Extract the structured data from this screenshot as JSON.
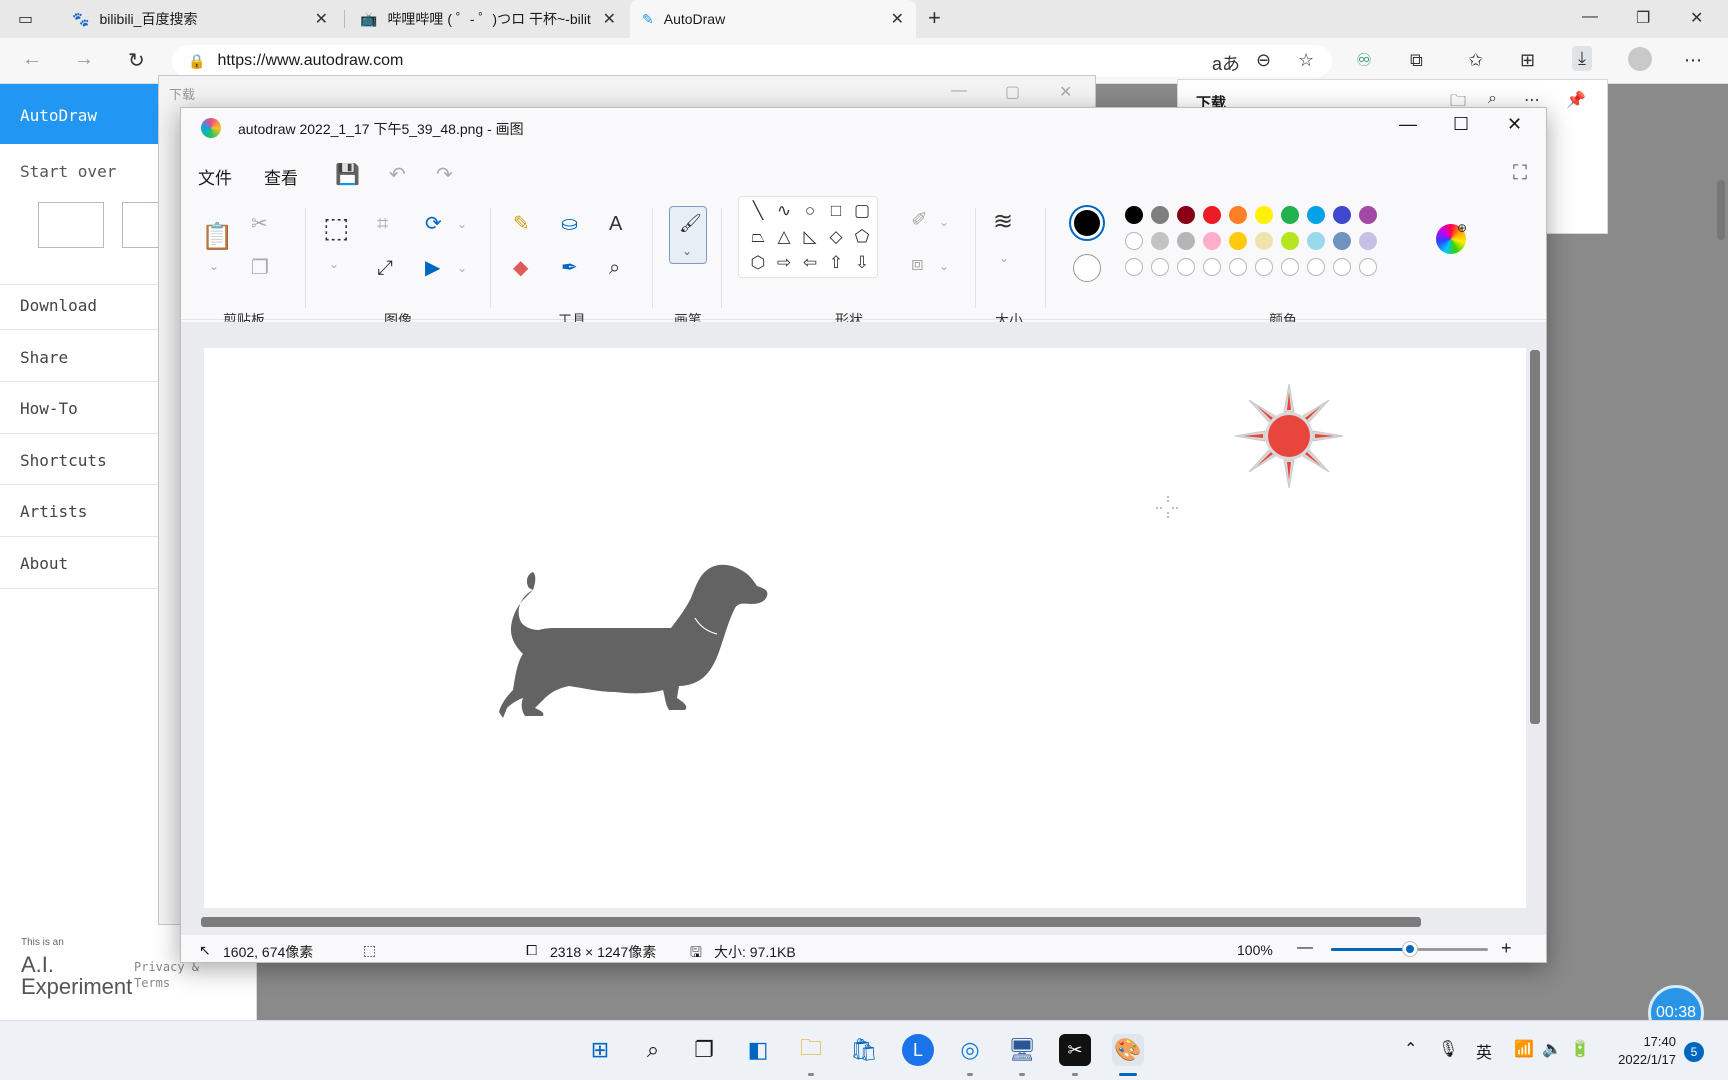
{
  "browser": {
    "tabs": [
      {
        "title": "bilibili_百度搜索"
      },
      {
        "title": "哔哩哔哩 ( ゜- ゜)つロ 干杯~-bilit"
      },
      {
        "title": "AutoDraw"
      }
    ],
    "new_tab": "+",
    "url": "https://www.autodraw.com"
  },
  "autodraw": {
    "brand": "AutoDraw",
    "start_over": "Start over",
    "menu": [
      "Download",
      "Share",
      "How-To",
      "Shortcuts",
      "Artists",
      "About"
    ],
    "footer_small": "This is an",
    "footer_brand_line1": "A.I.",
    "footer_brand_line2": "Experiment",
    "footer_links": [
      "Privacy &",
      "Terms"
    ]
  },
  "download_window": {
    "title": "下载"
  },
  "download_flyout": {
    "title": "下载"
  },
  "paint": {
    "title": "autodraw 2022_1_17 下午5_39_48.png - 画图",
    "menu": {
      "file": "文件",
      "view": "查看"
    },
    "groups": {
      "clipboard": "剪贴板",
      "image": "图像",
      "tools": "工具",
      "brushes": "画笔",
      "shapes": "形状",
      "size": "大小",
      "colors": "颜色"
    },
    "palette_row1": [
      "#000000",
      "#7f7f7f",
      "#880015",
      "#ed1c24",
      "#ff7f27",
      "#fff200",
      "#22b14c",
      "#00a2e8",
      "#3f48cc",
      "#a349a4"
    ],
    "palette_row2": [
      "#ffffff",
      "#c3c3c3",
      "#b5b5b5",
      "#ffaec9",
      "#ffc90e",
      "#efe4b0",
      "#b5e61d",
      "#99d9ea",
      "#7092be",
      "#c8bfe7"
    ],
    "primary_color": "#000000",
    "secondary_color": "#ffffff",
    "status": {
      "cursor_pos": "1602, 674像素",
      "image_size": "2318 × 1247像素",
      "file_size": "大小: 97.1KB",
      "zoom": "100%",
      "zoom_fraction": 0.5
    },
    "timer": "00:38"
  },
  "taskbar": {
    "tray_lang": "英",
    "time": "17:40",
    "date": "2022/1/17",
    "notifications": "5"
  }
}
